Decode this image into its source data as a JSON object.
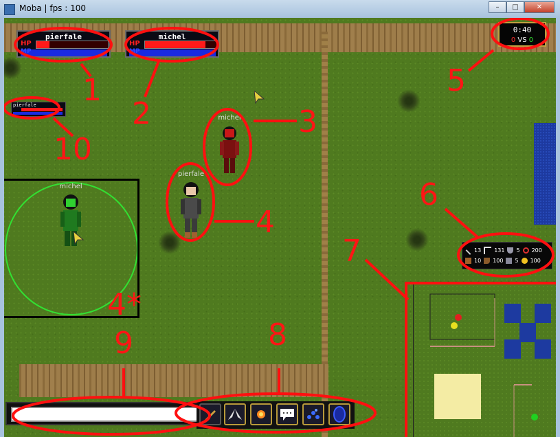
{
  "window": {
    "title": "Moba | fps : 100",
    "minimize_icon": "minimize-icon",
    "maximize_icon": "maximize-icon",
    "close_icon": "close-icon"
  },
  "player_bars": [
    {
      "name": "pierfale",
      "hp_label": "HP",
      "mp_label": "MP",
      "hp_fraction": 0.18,
      "mp_fraction": 1.0
    },
    {
      "name": "michel",
      "hp_label": "HP",
      "mp_label": "MP",
      "hp_fraction": 0.85,
      "mp_fraction": 1.0
    }
  ],
  "self_bar": {
    "name": "pierfale",
    "hp_label": "HP",
    "mp_label": "MP"
  },
  "timer": {
    "time": "0:40",
    "score_left": "0",
    "vs": "VS",
    "score_right": "0",
    "left_color": "#ff3030",
    "right_color": "#30e030"
  },
  "characters": [
    {
      "label": "michel",
      "color": "#b01818"
    },
    {
      "label": "pierfale",
      "color": "#555555"
    },
    {
      "label": "michel",
      "color": "#1f7a1f"
    }
  ],
  "stats": {
    "row1": [
      {
        "icon": "sword-icon",
        "value": "13"
      },
      {
        "icon": "claw-icon",
        "value": "131"
      },
      {
        "icon": "shield-icon",
        "value": "5"
      },
      {
        "icon": "target-icon",
        "value": "200"
      }
    ],
    "row2": [
      {
        "icon": "chest-icon",
        "value": "10"
      },
      {
        "icon": "boot-icon",
        "value": "100"
      },
      {
        "icon": "armor-icon",
        "value": "5"
      },
      {
        "icon": "coin-icon",
        "value": "100"
      }
    ]
  },
  "skills": [
    {
      "icon": "arrow-icon"
    },
    {
      "icon": "wings-icon"
    },
    {
      "icon": "fireball-icon"
    },
    {
      "icon": "chat-icon"
    },
    {
      "icon": "blue-dots-icon"
    },
    {
      "icon": "portal-icon"
    }
  ],
  "chat": {
    "value": ""
  },
  "annotations": [
    {
      "id": "1",
      "label": "1"
    },
    {
      "id": "2",
      "label": "2"
    },
    {
      "id": "3",
      "label": "3"
    },
    {
      "id": "4",
      "label": "4"
    },
    {
      "id": "4star",
      "label": "4*"
    },
    {
      "id": "5",
      "label": "5"
    },
    {
      "id": "6",
      "label": "6"
    },
    {
      "id": "7",
      "label": "7"
    },
    {
      "id": "8",
      "label": "8"
    },
    {
      "id": "9",
      "label": "9"
    },
    {
      "id": "10",
      "label": "10"
    }
  ]
}
